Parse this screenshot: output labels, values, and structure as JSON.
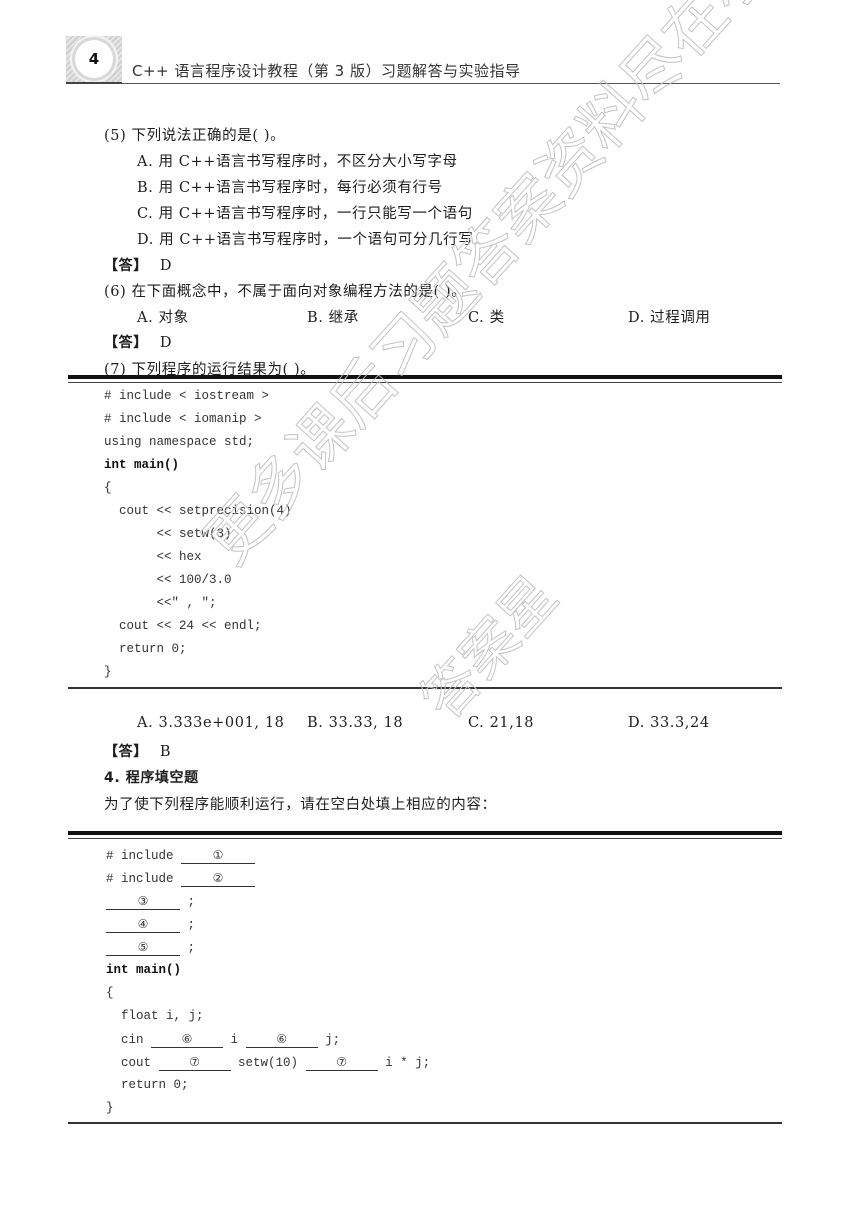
{
  "header": {
    "page_number": "4",
    "book_title": "C++ 语言程序设计教程（第 3 版）习题解答与实验指导"
  },
  "q5": {
    "question": "(5) 下列说法正确的是(      )。",
    "options": [
      "A. 用 C++语言书写程序时，不区分大小写字母",
      "B. 用 C++语言书写程序时，每行必须有行号",
      "C. 用 C++语言书写程序时，一行只能写一个语句",
      "D. 用 C++语言书写程序时，一个语句可分几行写"
    ],
    "answer_label": "【答】",
    "answer": "D"
  },
  "q6": {
    "question": "(6) 在下面概念中，不属于面向对象编程方法的是(      )。",
    "options": [
      "A. 对象",
      "B. 继承",
      "C. 类",
      "D. 过程调用"
    ],
    "answer_label": "【答】",
    "answer": "D"
  },
  "q7": {
    "question": "(7) 下列程序的运行结果为(      )。",
    "code": [
      "# include < iostream >",
      "# include < iomanip >",
      "using namespace std;",
      "int main()",
      "{",
      "  cout << setprecision(4)",
      "       << setw(3)",
      "       << hex",
      "       << 100/3.0",
      "       <<\" , \";",
      "  cout << 24 << endl;",
      "  return 0;",
      "}"
    ],
    "options": [
      "A. 3.333e+001, 18",
      "B. 33.33, 18",
      "C. 21,18",
      "D. 33.3,24"
    ],
    "answer_label": "【答】",
    "answer": "B"
  },
  "section4": {
    "title": "4. 程序填空题",
    "instruction": "为了使下列程序能顺利运行，请在空白处填上相应的内容：",
    "code": {
      "include": "# include",
      "semicolon": ";",
      "int_main": "int main()",
      "open_brace": "{",
      "float_decl": "float i, j;",
      "cin": "cin",
      "i": "i",
      "j_end": "j;",
      "cout": "cout",
      "setw": "setw(10)",
      "ixj": "i * j;",
      "return": "return 0;",
      "close_brace": "}"
    },
    "blanks": [
      "①",
      "②",
      "③",
      "④",
      "⑤",
      "⑥",
      "⑦"
    ]
  },
  "watermark": {
    "line1": "更多课后习题答案资料尽在小程序",
    "line2": "答案星"
  }
}
